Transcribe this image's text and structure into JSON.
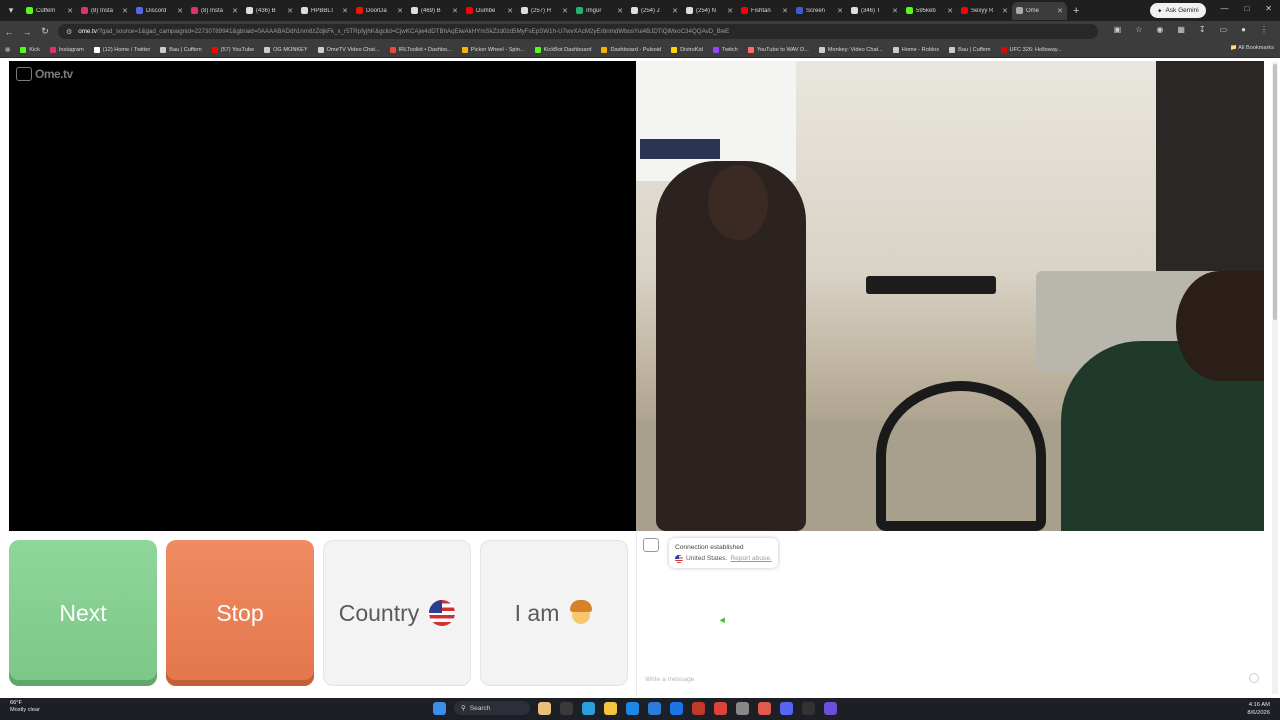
{
  "browser": {
    "tabs": [
      {
        "label": "Cuffem",
        "color": "#53fc18"
      },
      {
        "label": "(8) Insta",
        "color": "#e1306c"
      },
      {
        "label": "Discord",
        "color": "#5865f2"
      },
      {
        "label": "(8) Insta",
        "color": "#e1306c"
      },
      {
        "label": "(436) B",
        "color": "#dddddd"
      },
      {
        "label": "HPBBLT",
        "color": "#dddddd"
      },
      {
        "label": "DoorDa",
        "color": "#eb1700"
      },
      {
        "label": "(469) B",
        "color": "#dddddd"
      },
      {
        "label": "Dumbe",
        "color": "#ff0000"
      },
      {
        "label": "(257) H",
        "color": "#dddddd"
      },
      {
        "label": "Imgur",
        "color": "#1bb76e"
      },
      {
        "label": "(254) J",
        "color": "#dddddd"
      },
      {
        "label": "(254) N",
        "color": "#dddddd"
      },
      {
        "label": "Fishtan",
        "color": "#ff0000"
      },
      {
        "label": "Screen",
        "color": "#3b5bdb"
      },
      {
        "label": "(346) T",
        "color": "#dddddd"
      },
      {
        "label": "595keb",
        "color": "#53fc18"
      },
      {
        "label": "Sexyy R",
        "color": "#ff0000"
      },
      {
        "label": "Ome",
        "color": "#aaaaaa",
        "active": true
      }
    ],
    "ask_gemini": "Ask Gemini",
    "url_host": "ome.tv",
    "url_rest": "/?gad_source=1&gad_campaignid=22730789941&gbraid=0AAAABADdh1nm8zZdjkFk_x_r5TRpfyjhK&gclid=CjwKCAjw4dDTBhAqEiwAkHYmSkZzd0zd5MyFsEpSW1h-U7wvXAcM2yEr8nmdWbosYui4BJDTiQiMxoC34QQAvD_BwE",
    "bookmarks": [
      {
        "label": "Kick",
        "color": "#53fc18"
      },
      {
        "label": "Instagram",
        "color": "#e1306c"
      },
      {
        "label": "(12) Home / Twitter",
        "color": "#ffffff"
      },
      {
        "label": "Bau | Cuffem",
        "color": "#cccccc"
      },
      {
        "label": "(57) YouTube",
        "color": "#ff0000"
      },
      {
        "label": "OG MONKEY",
        "color": "#cccccc"
      },
      {
        "label": "OmeTV Video Chat...",
        "color": "#cccccc"
      },
      {
        "label": "IRLToolkit • Dashbo...",
        "color": "#e84a3c"
      },
      {
        "label": "Picker Wheel - Spin...",
        "color": "#f4b400"
      },
      {
        "label": "KickBot Dashboard",
        "color": "#53fc18"
      },
      {
        "label": "Dashboard - Pulsoid",
        "color": "#f4b400"
      },
      {
        "label": "DistroKid",
        "color": "#ffd400"
      },
      {
        "label": "Twitch",
        "color": "#9146ff"
      },
      {
        "label": "YouTube to WAV D...",
        "color": "#ff6b6b"
      },
      {
        "label": "Monkey: Video Chat...",
        "color": "#cccccc"
      },
      {
        "label": "Home - Roblox",
        "color": "#cccccc"
      },
      {
        "label": "Bau | Cuffem",
        "color": "#cccccc"
      },
      {
        "label": "UFC 326: Holloway...",
        "color": "#d20a0a"
      }
    ],
    "all_bookmarks": "All Bookmarks"
  },
  "page": {
    "logo_text": "Ome.tv",
    "buttons": {
      "next": "Next",
      "stop": "Stop",
      "country": "Country",
      "iam": "I am"
    },
    "chat": {
      "status": "Connection established",
      "country": "United States.",
      "report": "Report abuse.",
      "placeholder": "Write a message"
    }
  },
  "taskbar": {
    "weather_temp": "66°F",
    "weather_desc": "Mostly clear",
    "search_label": "Search",
    "time": "4:16 AM",
    "date": "8/6/2026",
    "app_icons": [
      "#e8c07a",
      "#3a3a3a",
      "#2b9fd9",
      "#f5c542",
      "#1e88e5",
      "#2b7bd9",
      "#1a73e8",
      "#c0392b",
      "#db4437",
      "#888888",
      "#e05a4f",
      "#5865f2",
      "#333333",
      "#6b4fd8"
    ]
  }
}
